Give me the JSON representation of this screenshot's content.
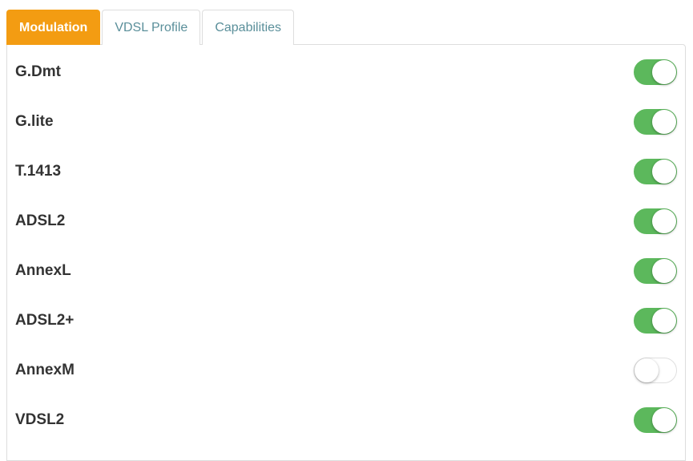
{
  "tabs": [
    {
      "label": "Modulation",
      "active": true
    },
    {
      "label": "VDSL Profile",
      "active": false
    },
    {
      "label": "Capabilities",
      "active": false
    }
  ],
  "modulation": {
    "items": [
      {
        "label": "G.Dmt",
        "enabled": true
      },
      {
        "label": "G.lite",
        "enabled": true
      },
      {
        "label": "T.1413",
        "enabled": true
      },
      {
        "label": "ADSL2",
        "enabled": true
      },
      {
        "label": "AnnexL",
        "enabled": true
      },
      {
        "label": "ADSL2+",
        "enabled": true
      },
      {
        "label": "AnnexM",
        "enabled": false
      },
      {
        "label": "VDSL2",
        "enabled": true
      }
    ]
  },
  "colors": {
    "active_tab": "#f39c12",
    "toggle_on": "#5cb85c",
    "tab_text": "#5a8f9a"
  }
}
